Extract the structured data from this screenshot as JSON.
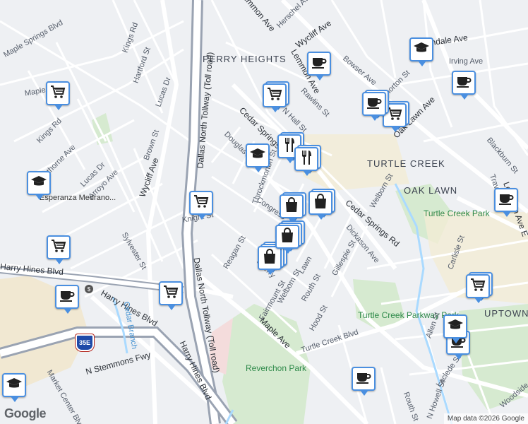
{
  "areas": [
    "PERRY HEIGHTS",
    "TURTLE CREEK",
    "OAK LAWN",
    "UPTOWN"
  ],
  "parks": [
    "Turtle Creek Park",
    "Turtle Creek Parkway Park",
    "Reverchon Park"
  ],
  "streets": [
    "Maple Springs Blvd",
    "Kings Rd",
    "Hartford St",
    "Lucas Dr",
    "Maple",
    "Kings Rd",
    "Hawthorne Ave",
    "Lucas Dr",
    "Arroyo Ave",
    "Brown St",
    "Wycliff Ave",
    "Dallas North Tollway (Toll road)",
    "Sylvester St",
    "Harry Hines Blvd",
    "N Stemmons Fwy",
    "Market Center Blvd",
    "Cedar Branch",
    "Lemmon Ave",
    "Herschel Ave",
    "Wycliff Ave",
    "Lemmon Ave",
    "Rawlins St",
    "N Hall St",
    "Cedar Springs",
    "Douglas Ave",
    "Throckmorton St",
    "Congress",
    "Knight St",
    "Reagan St",
    "Sherry",
    "Lawn",
    "Welborn St",
    "Routh St",
    "Gillespie St",
    "Fairmount St",
    "Hood St",
    "Maple Ave",
    "Turtle Creek Blvd",
    "Cedar Springs Rd",
    "Dickason Ave",
    "Welborn St",
    "Oak Lawn Ave",
    "Bowser Ave",
    "Throckmorton St",
    "Avondale Ave",
    "Irving Ave",
    "Blackburn St",
    "Travis St",
    "Lemmon Ave E",
    "Carlisle St",
    "Allen St",
    "Laclede St",
    "N Howell St",
    "Routh St",
    "Woodside St"
  ],
  "poi_labels": [
    "Esperanza\nMedrano..."
  ],
  "shields": [
    "35E",
    "$"
  ],
  "pins": [
    {
      "type": "shopping-cart",
      "count": 1
    },
    {
      "type": "shopping-cart",
      "count": 2
    },
    {
      "type": "shopping-cart",
      "count": 1
    },
    {
      "type": "shopping-cart",
      "count": 1
    },
    {
      "type": "shopping-cart",
      "count": 1
    },
    {
      "type": "shopping-cart",
      "count": 2
    },
    {
      "type": "shopping-cart",
      "count": 2
    },
    {
      "type": "coffee-cup",
      "count": 1
    },
    {
      "type": "coffee-cup",
      "count": 1
    },
    {
      "type": "coffee-cup",
      "count": 1
    },
    {
      "type": "coffee-cup",
      "count": 2
    },
    {
      "type": "coffee-cup",
      "count": 1
    },
    {
      "type": "coffee-cup",
      "count": 1
    },
    {
      "type": "coffee-cup",
      "count": 1
    },
    {
      "type": "graduation-cap",
      "count": 1
    },
    {
      "type": "graduation-cap",
      "count": 1
    },
    {
      "type": "graduation-cap",
      "count": 1
    },
    {
      "type": "graduation-cap",
      "count": 1
    },
    {
      "type": "graduation-cap",
      "count": 1
    },
    {
      "type": "fork-knife",
      "count": 2
    },
    {
      "type": "fork-knife",
      "count": 2
    },
    {
      "type": "shopping-bag",
      "count": 2
    },
    {
      "type": "shopping-bag",
      "count": 2
    },
    {
      "type": "shopping-bag",
      "count": 3
    },
    {
      "type": "shopping-bag",
      "count": 3
    }
  ],
  "colors": {
    "pin_border": "#4a8fe0",
    "pin_icon": "#1a1a1a",
    "park": "#d6ead0",
    "road": "#ffffff"
  },
  "footer": {
    "logo": "Google",
    "map_data": "Map data ©2026 Google"
  }
}
